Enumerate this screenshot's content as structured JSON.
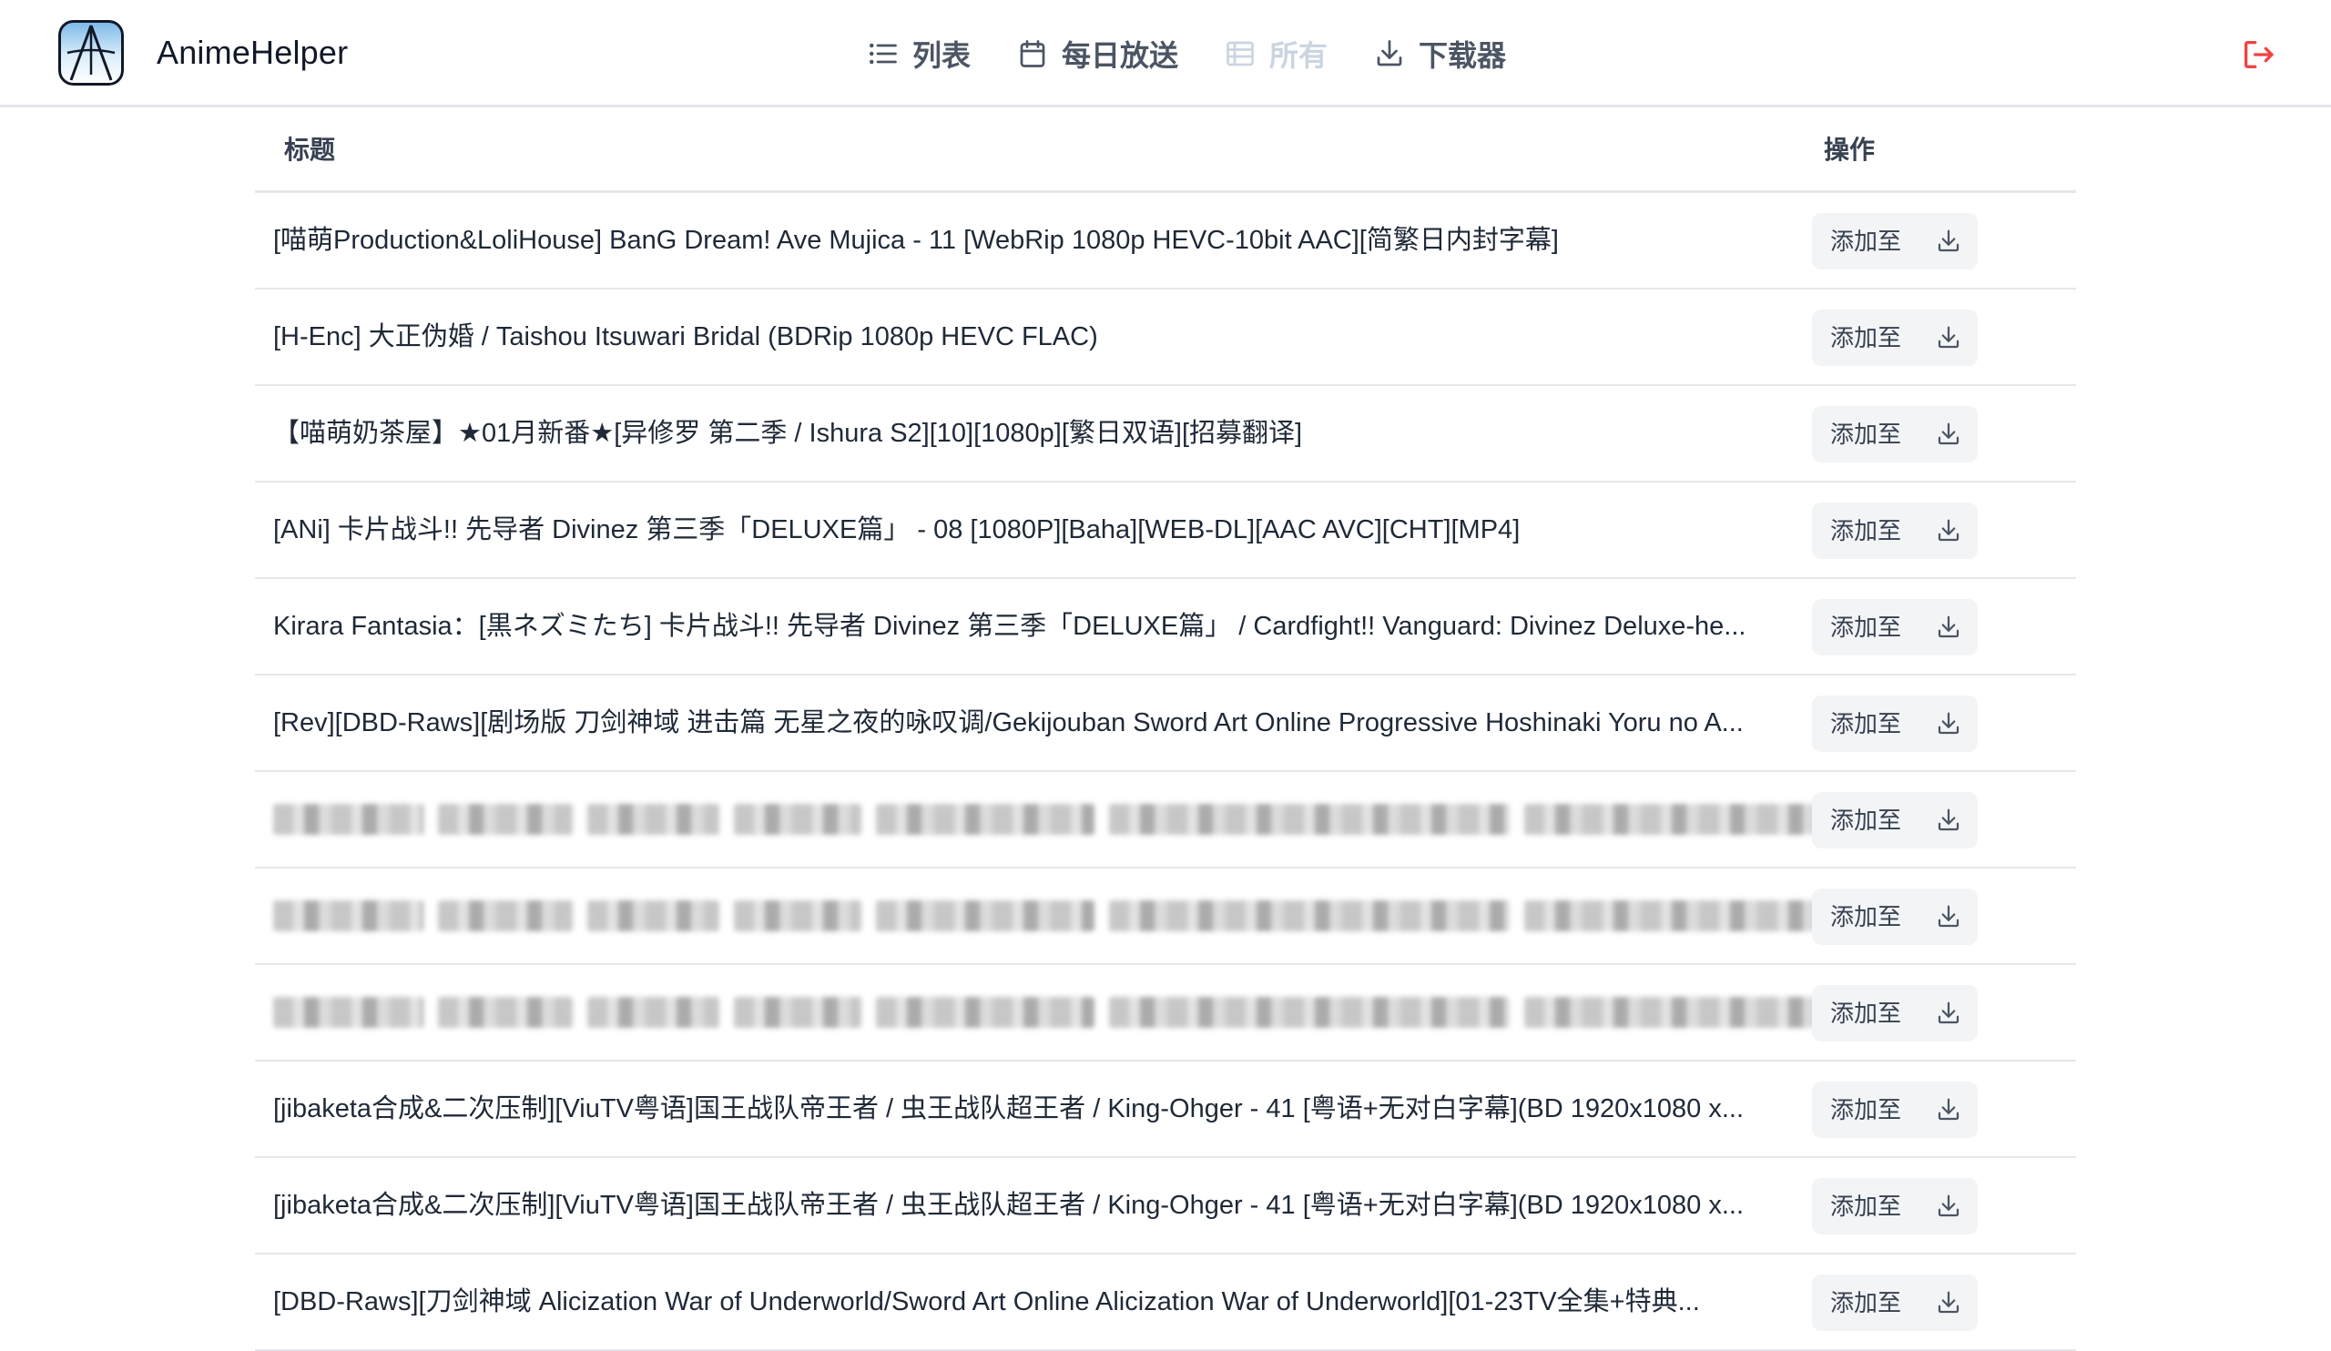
{
  "app": {
    "name": "AnimeHelper",
    "accent_color": "#ef4444"
  },
  "nav": {
    "items": [
      {
        "label": "列表",
        "icon": "list-icon",
        "enabled": true
      },
      {
        "label": "每日放送",
        "icon": "calendar-icon",
        "enabled": true
      },
      {
        "label": "所有",
        "icon": "table-icon",
        "enabled": false
      },
      {
        "label": "下载器",
        "icon": "download-icon",
        "enabled": true
      }
    ],
    "logout_icon": "logout-icon"
  },
  "table": {
    "headers": {
      "title": "标题",
      "action": "操作"
    },
    "add_label": "添加至",
    "rows": [
      {
        "title": "[喵萌Production&LoliHouse] BanG Dream! Ave Mujica - 11 [WebRip 1080p HEVC-10bit AAC][简繁日内封字幕]",
        "blurred": false
      },
      {
        "title": "[H-Enc] 大正伪婚 / Taishou Itsuwari Bridal (BDRip 1080p HEVC FLAC)",
        "blurred": false
      },
      {
        "title": "【喵萌奶茶屋】★01月新番★[异修罗 第二季 / Ishura S2][10][1080p][繁日双语][招募翻译]",
        "blurred": false
      },
      {
        "title": "[ANi] 卡片战斗!! 先导者 Divinez 第三季「DELUXE篇」 - 08 [1080P][Baha][WEB-DL][AAC AVC][CHT][MP4]",
        "blurred": false
      },
      {
        "title": "Kirara Fantasia：[黒ネズミたち] 卡片战斗!! 先导者 Divinez 第三季「DELUXE篇」 / Cardfight!! Vanguard: Divinez Deluxe-he...",
        "blurred": false
      },
      {
        "title": "[Rev][DBD-Raws][剧场版 刀剑神域 进击篇 无星之夜的咏叹调/Gekijouban Sword Art Online Progressive Hoshinaki Yoru no A...",
        "blurred": false
      },
      {
        "title": "",
        "blurred": true
      },
      {
        "title": "",
        "blurred": true
      },
      {
        "title": "",
        "blurred": true
      },
      {
        "title": "[jibaketa合成&二次压制][ViuTV粤语]国王战队帝王者 / 虫王战队超王者 / King-Ohger - 41 [粤语+无对白字幕](BD 1920x1080 x...",
        "blurred": false
      },
      {
        "title": "[jibaketa合成&二次压制][ViuTV粤语]国王战队帝王者 / 虫王战队超王者 / King-Ohger - 41 [粤语+无对白字幕](BD 1920x1080 x...",
        "blurred": false
      },
      {
        "title": "[DBD-Raws][刀剑神域 Alicization War of Underworld/Sword Art Online Alicization War of Underworld][01-23TV全集+特典...",
        "blurred": false
      }
    ]
  }
}
